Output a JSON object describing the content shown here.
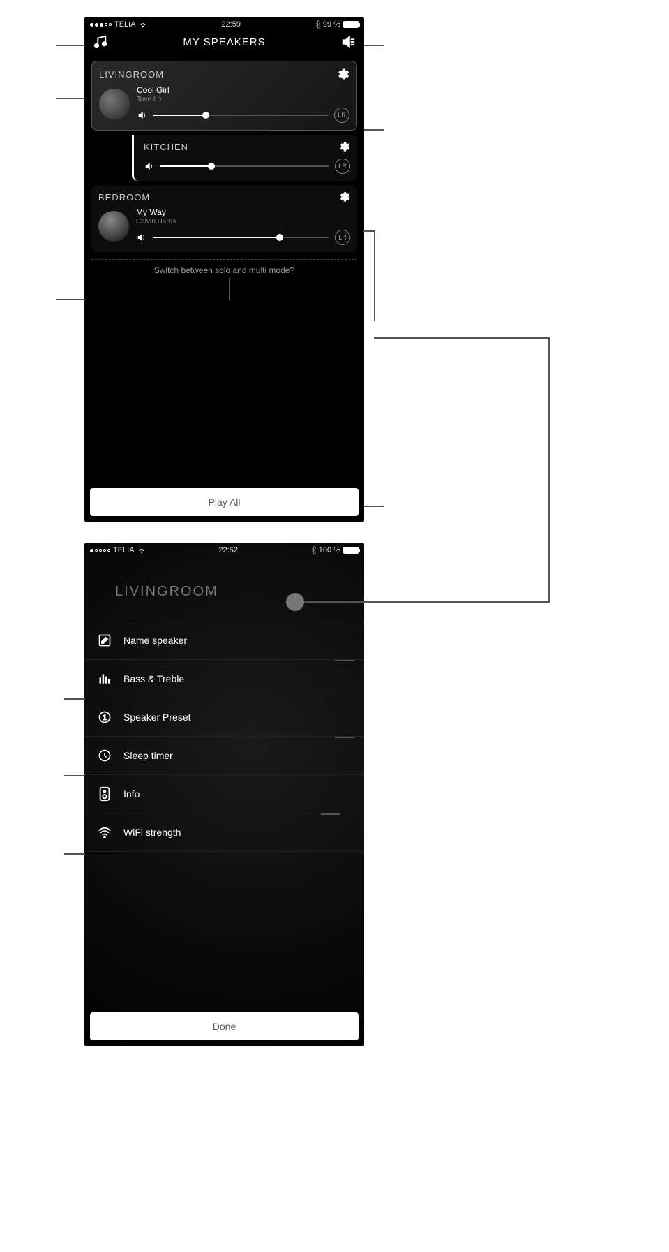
{
  "screen1": {
    "status": {
      "carrier": "TELIA",
      "time": "22:59",
      "battery_pct": "99 %",
      "signal_dots_filled": 3
    },
    "header": {
      "title": "MY SPEAKERS"
    },
    "speakers": [
      {
        "name": "LIVINGROOM",
        "highlighted": true,
        "song": {
          "title": "Cool Girl",
          "artist": "Tove Lo"
        },
        "volume_pct": 30,
        "channel": "LR",
        "children": [
          {
            "name": "KITCHEN",
            "volume_pct": 30,
            "channel": "LR"
          }
        ]
      },
      {
        "name": "BEDROOM",
        "song": {
          "title": "My Way",
          "artist": "Calvin Harris"
        },
        "volume_pct": 72,
        "channel": "LR"
      }
    ],
    "hint": "Switch between solo and multi mode?",
    "play_all": "Play All"
  },
  "screen2": {
    "status": {
      "carrier": "TELIA",
      "time": "22:52",
      "battery_pct": "100 %",
      "signal_dots_filled": 1
    },
    "title": "LIVINGROOM",
    "items": [
      {
        "icon": "edit-icon",
        "label": "Name speaker"
      },
      {
        "icon": "eq-icon",
        "label": "Bass & Treble"
      },
      {
        "icon": "preset-icon",
        "label": "Speaker Preset"
      },
      {
        "icon": "clock-icon",
        "label": "Sleep timer"
      },
      {
        "icon": "info-icon",
        "label": "Info"
      },
      {
        "icon": "wifi-icon",
        "label": "WiFi strength"
      }
    ],
    "done": "Done"
  }
}
